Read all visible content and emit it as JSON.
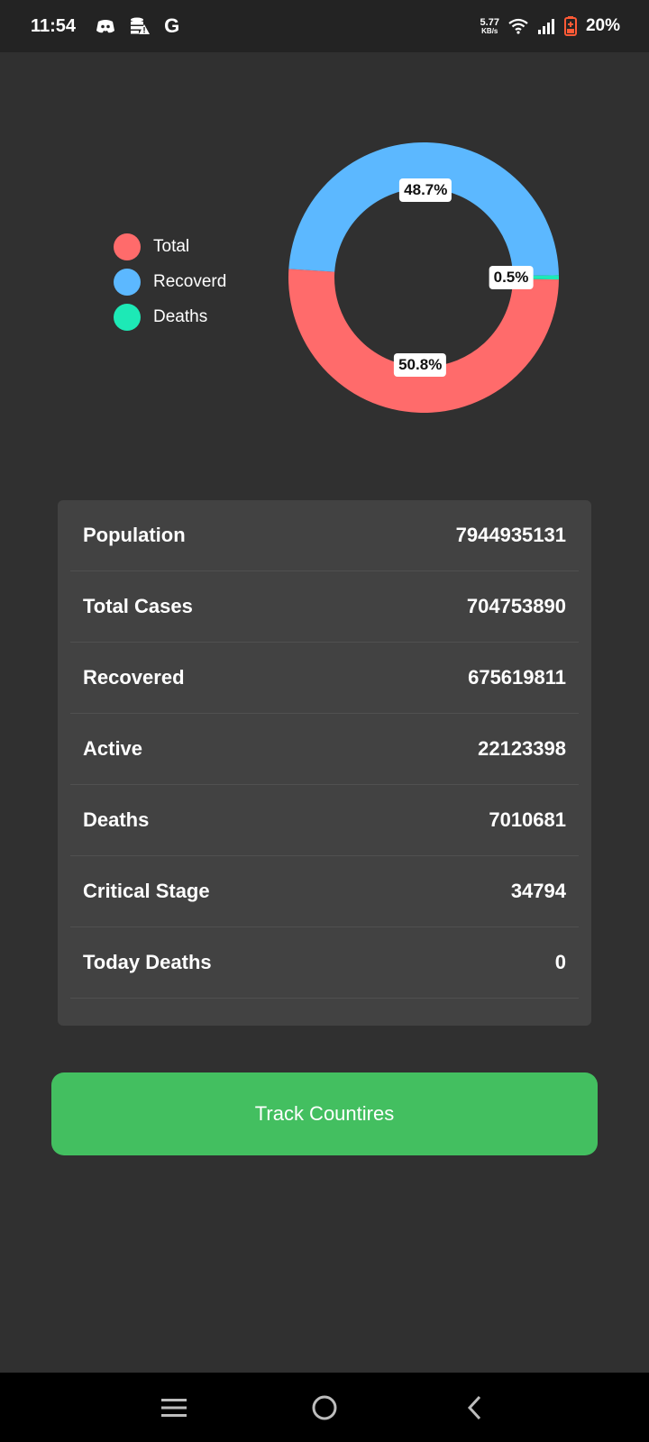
{
  "status_bar": {
    "time": "11:54",
    "left_icons": [
      "discord-icon",
      "database-alert-icon",
      "google-icon"
    ],
    "google_letter": "G",
    "net_speed_value": "5.77",
    "net_speed_unit": "KB/s",
    "battery_percent": "20%"
  },
  "chart_data": {
    "type": "pie",
    "style": "donut",
    "legend_position": "left",
    "categories": [
      "Total",
      "Recoverd",
      "Deaths"
    ],
    "values": [
      50.8,
      48.7,
      0.5
    ],
    "labels": [
      "50.8%",
      "48.7%",
      "0.5%"
    ],
    "colors": [
      "#ff6b6b",
      "#5cb8ff",
      "#1de9b6"
    ]
  },
  "stats": [
    {
      "label": "Population",
      "value": "7944935131"
    },
    {
      "label": "Total Cases",
      "value": "704753890"
    },
    {
      "label": "Recovered",
      "value": "675619811"
    },
    {
      "label": "Active",
      "value": "22123398"
    },
    {
      "label": "Deaths",
      "value": "7010681"
    },
    {
      "label": "Critical Stage",
      "value": "34794"
    },
    {
      "label": "Today Deaths",
      "value": "0"
    }
  ],
  "button": {
    "label": "Track Countires",
    "color": "#43bf60"
  },
  "nav_bar": {
    "icons": [
      "menu-icon",
      "home-icon",
      "back-icon"
    ]
  }
}
